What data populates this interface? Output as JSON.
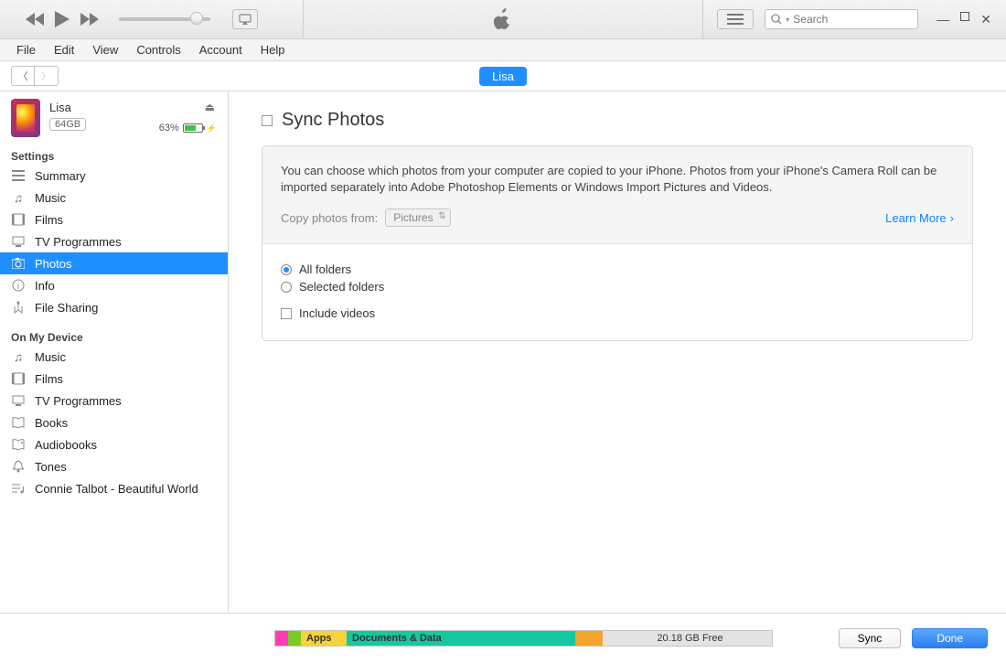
{
  "title_bar": {
    "search_placeholder": "Search"
  },
  "menubar": [
    "File",
    "Edit",
    "View",
    "Controls",
    "Account",
    "Help"
  ],
  "device": {
    "name": "Lisa",
    "capacity_label": "64GB",
    "battery_pct": "63%"
  },
  "device_pill": "Lisa",
  "sidebar": {
    "settings_heading": "Settings",
    "settings": [
      {
        "label": "Summary",
        "icon": "list"
      },
      {
        "label": "Music",
        "icon": "note"
      },
      {
        "label": "Films",
        "icon": "film"
      },
      {
        "label": "TV Programmes",
        "icon": "tv"
      },
      {
        "label": "Photos",
        "icon": "camera",
        "selected": true
      },
      {
        "label": "Info",
        "icon": "info"
      },
      {
        "label": "File Sharing",
        "icon": "share"
      }
    ],
    "ondevice_heading": "On My Device",
    "ondevice": [
      {
        "label": "Music",
        "icon": "note"
      },
      {
        "label": "Films",
        "icon": "film"
      },
      {
        "label": "TV Programmes",
        "icon": "tv"
      },
      {
        "label": "Books",
        "icon": "book"
      },
      {
        "label": "Audiobooks",
        "icon": "audiobook"
      },
      {
        "label": "Tones",
        "icon": "bell"
      },
      {
        "label": "Connie Talbot - Beautiful World",
        "icon": "playlist"
      }
    ]
  },
  "content": {
    "section_title": "Sync Photos",
    "info_text": "You can choose which photos from your computer are copied to your iPhone. Photos from your iPhone's Camera Roll can be imported separately into Adobe Photoshop Elements or Windows Import Pictures and Videos.",
    "copy_label": "Copy photos from:",
    "copy_source": "Pictures",
    "learn_more": "Learn More",
    "opt_all": "All folders",
    "opt_selected": "Selected folders",
    "opt_include": "Include videos"
  },
  "storage": {
    "apps_label": "Apps",
    "docs_label": "Documents & Data",
    "free_label": "20.18 GB Free"
  },
  "buttons": {
    "sync": "Sync",
    "done": "Done"
  }
}
